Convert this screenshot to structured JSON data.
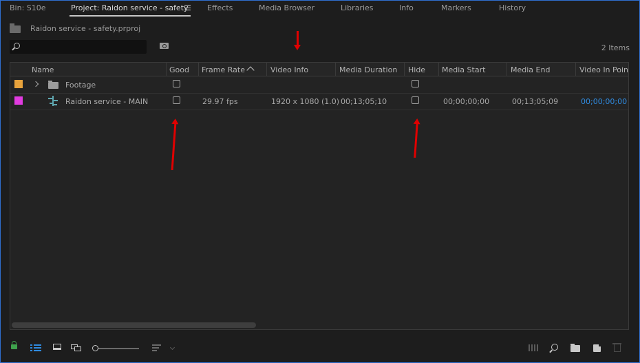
{
  "tabs": [
    {
      "label": "Bin: S10e"
    },
    {
      "label": "Project: Raidon service  - safety"
    },
    {
      "label": "Effects"
    },
    {
      "label": "Media Browser"
    },
    {
      "label": "Libraries"
    },
    {
      "label": "Info"
    },
    {
      "label": "Markers"
    },
    {
      "label": "History"
    }
  ],
  "project": {
    "file_name": "Raidon service  - safety.prproj",
    "item_count": "2 Items"
  },
  "search": {
    "value": "",
    "placeholder": ""
  },
  "columns": [
    "Name",
    "Good",
    "Frame Rate",
    "Video Info",
    "Media Duration",
    "Hide",
    "Media Start",
    "Media End",
    "Video In Point"
  ],
  "rows": [
    {
      "label_color": "#e8a33c",
      "icon": "folder-icon",
      "name": "Footage",
      "good_checked": false,
      "frame_rate": "",
      "video_info": "",
      "media_duration": "",
      "hide_checked": false,
      "media_start": "",
      "media_end": "",
      "video_in_point": ""
    },
    {
      "label_color": "#e13be0",
      "icon": "sequence-icon",
      "name": "Raidon service - MAIN",
      "good_checked": false,
      "frame_rate": "29.97 fps",
      "video_info": "1920 x 1080 (1.0)",
      "media_duration": "00;13;05;10",
      "hide_checked": false,
      "media_start": "00;00;00;00",
      "media_end": "00;13;05;09",
      "video_in_point": "00;00;00;00"
    }
  ],
  "colors": {
    "accent_blue": "#2f8be0",
    "lock_green": "#3fa34d",
    "annotation_red": "#e00000"
  }
}
